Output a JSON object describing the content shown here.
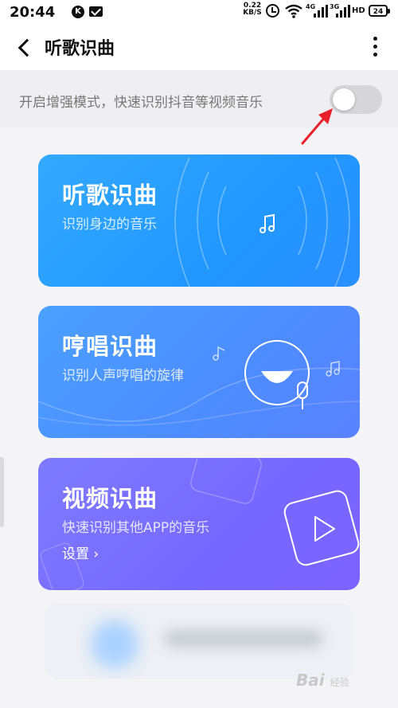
{
  "status_bar": {
    "time": "20:44",
    "k_badge": "K",
    "speed_value": "0.22",
    "speed_unit": "KB/S",
    "net_label_1": "4G",
    "net_label_2": "3G",
    "hd": "HD",
    "battery": "24"
  },
  "header": {
    "title": "听歌识曲"
  },
  "enhance": {
    "text": "开启增强模式，快速识别抖音等视频音乐",
    "enabled": false
  },
  "cards": [
    {
      "title": "听歌识曲",
      "subtitle": "识别身边的音乐"
    },
    {
      "title": "哼唱识曲",
      "subtitle": "识别人声哼唱的旋律"
    },
    {
      "title": "视频识曲",
      "subtitle": "快速识别其他APP的音乐",
      "link": "设置 ›"
    }
  ],
  "watermark": {
    "brand": "Bai",
    "suffix": "经验"
  },
  "colors": {
    "card1": "#2198ff",
    "card2": "#4d8cff",
    "card3": "#7668ff",
    "annotation_arrow": "#e8202a"
  }
}
